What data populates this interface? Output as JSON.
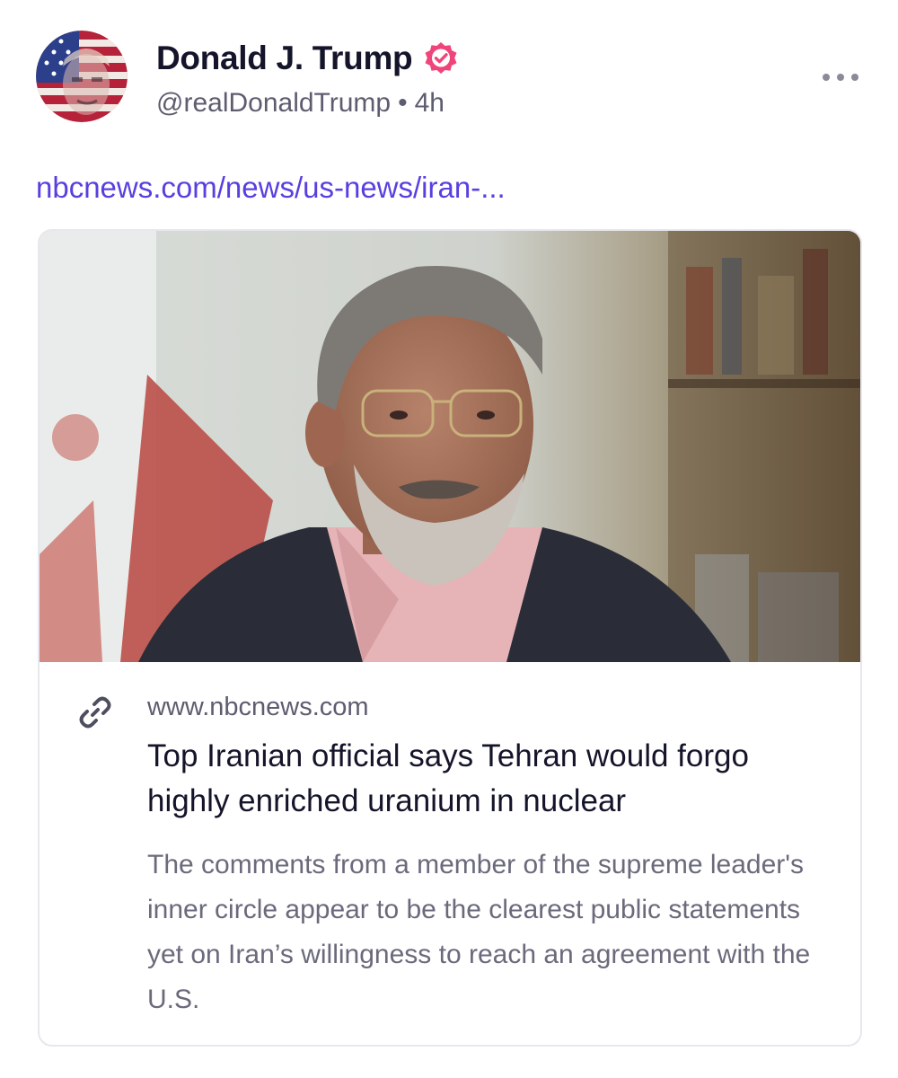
{
  "post": {
    "author": {
      "display_name": "Donald J. Trump",
      "handle": "@realDonaldTrump",
      "timestamp": "4h",
      "separator": "•",
      "verified": true,
      "avatar_icon": "user-avatar",
      "badge_icon": "verified-badge-icon",
      "badge_color": "#f0457a"
    },
    "more_icon": "more-options-icon",
    "link_text": "nbcnews.com/news/us-news/iran-...",
    "link_color": "#5a3fe0",
    "card": {
      "image_icon": "article-photo",
      "link_icon": "link-icon",
      "domain": "www.nbcnews.com",
      "title": "Top Iranian official says Tehran would forgo highly enriched uranium in nuclear",
      "description": "The comments from a member of the supreme leader's inner circle appear to be the clearest public statements yet on Iran’s willingness to reach an agreement with the U.S."
    }
  }
}
